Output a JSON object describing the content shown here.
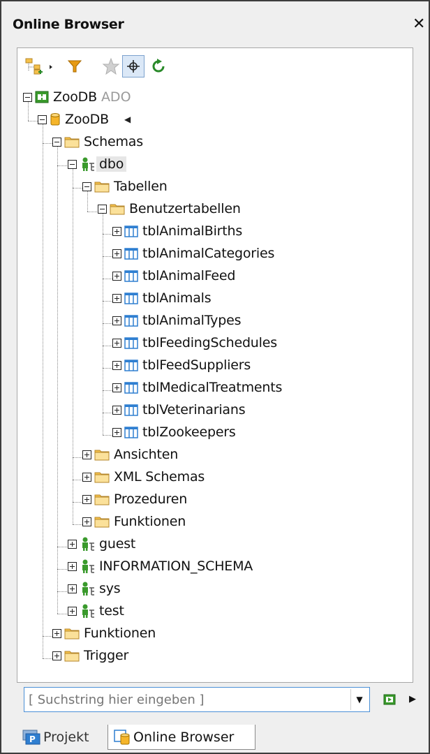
{
  "window": {
    "title": "Online Browser"
  },
  "toolbar": {
    "buttons": [
      {
        "name": "add-datasource-icon"
      },
      {
        "name": "filter-icon"
      },
      {
        "name": "favorites-star-icon"
      },
      {
        "name": "locate-crosshair-icon"
      },
      {
        "name": "refresh-icon"
      }
    ]
  },
  "tree": {
    "root": {
      "label": "ZooDB",
      "sublabel": "ADO"
    },
    "database": {
      "label": "ZooDB"
    },
    "schemas_folder": "Schemas",
    "dbo": "dbo",
    "tabellen": "Tabellen",
    "benutzertabellen": "Benutzertabellen",
    "tables": [
      "tblAnimalBirths",
      "tblAnimalCategories",
      "tblAnimalFeed",
      "tblAnimals",
      "tblAnimalTypes",
      "tblFeedingSchedules",
      "tblFeedSuppliers",
      "tblMedicalTreatments",
      "tblVeterinarians",
      "tblZookeepers"
    ],
    "dbo_folders": [
      "Ansichten",
      "XML Schemas",
      "Prozeduren",
      "Funktionen"
    ],
    "other_schemas": [
      "guest",
      "INFORMATION_SCHEMA",
      "sys",
      "test"
    ],
    "db_folders": [
      "Funktionen",
      "Trigger"
    ]
  },
  "search": {
    "placeholder": "[ Suchstring hier eingeben ]"
  },
  "tabs": [
    {
      "label": "Projekt",
      "active": false
    },
    {
      "label": "Online Browser",
      "active": true
    }
  ],
  "colors": {
    "folder": "#f5c14b",
    "table": "#2f7fd1",
    "schema_person": "#3a9a2c",
    "refresh": "#2a8a2a",
    "filter": "#e69a14"
  }
}
